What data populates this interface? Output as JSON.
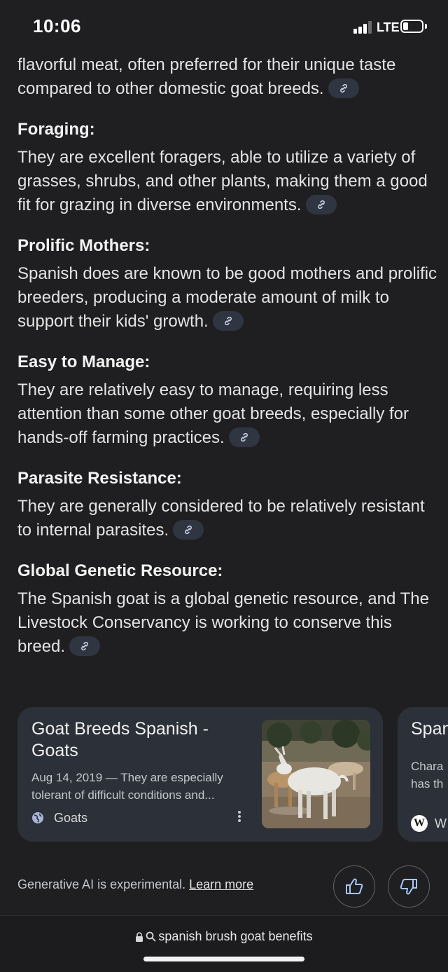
{
  "status_bar": {
    "time": "10:06",
    "network": "LTE",
    "battery_icon": "battery-icon"
  },
  "content": {
    "intro": "flavorful meat, often preferred for their unique taste compared to other domestic goat breeds.",
    "sections": [
      {
        "heading": "Foraging:",
        "text": "They are excellent foragers, able to utilize a variety of grasses, shrubs, and other plants, making them a good fit for grazing in diverse environments."
      },
      {
        "heading": "Prolific Mothers:",
        "text": "Spanish does are known to be good mothers and prolific breeders, producing a moderate amount of milk to support their kids' growth."
      },
      {
        "heading": "Easy to Manage:",
        "text": "They are relatively easy to manage, requiring less attention than some other goat breeds, especially for hands-off farming practices."
      },
      {
        "heading": "Parasite Resistance:",
        "text": "They are generally considered to be relatively resistant to internal parasites."
      },
      {
        "heading": "Global Genetic Resource:",
        "text": "The Spanish goat is a global genetic resource, and The Livestock Conservancy is working to conserve this breed."
      }
    ]
  },
  "sources": {
    "card1": {
      "title": "Goat Breeds Spanish - Goats",
      "snippet": "Aug 14, 2019 — They are especially tolerant of difficult conditions and...",
      "source_name": "Goats",
      "icon": "globe-icon"
    },
    "card2": {
      "title": "Span",
      "snippet": "Chara\nhas th",
      "source_name": "W",
      "icon": "wikipedia-icon"
    }
  },
  "footer": {
    "disclaimer": "Generative AI is experimental.",
    "learn_more": "Learn more",
    "thumbs_up_icon": "thumbs-up-icon",
    "thumbs_down_icon": "thumbs-down-icon"
  },
  "address_bar": {
    "query": "spanish brush goat benefits"
  },
  "colors": {
    "background": "#1f1f21",
    "card": "#2c3038",
    "chip": "#2f3541",
    "text": "#e3e3e3"
  }
}
